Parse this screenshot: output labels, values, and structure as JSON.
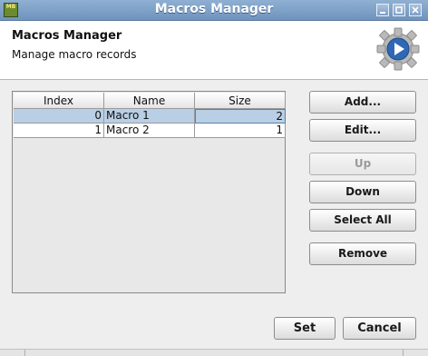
{
  "window": {
    "title": "Macros Manager",
    "icon_text": "MB",
    "controls": [
      "minimize-icon",
      "maximize-icon",
      "close-icon"
    ]
  },
  "header": {
    "title": "Macros Manager",
    "subtitle": "Manage macro records",
    "icon": "macro-play-icon"
  },
  "table": {
    "columns": [
      "Index",
      "Name",
      "Size"
    ],
    "rows": [
      {
        "index": "0",
        "name": "Macro 1",
        "size": "2",
        "selected": true
      },
      {
        "index": "1",
        "name": "Macro 2",
        "size": "1",
        "selected": false
      }
    ]
  },
  "buttons": {
    "add": "Add...",
    "edit": "Edit...",
    "up": "Up",
    "down": "Down",
    "select_all": "Select All",
    "remove": "Remove",
    "set": "Set",
    "cancel": "Cancel"
  },
  "colors": {
    "title_bar": "#7f9fc6",
    "selection": "#b8cfe5",
    "icon_blue": "#2f68b5"
  }
}
